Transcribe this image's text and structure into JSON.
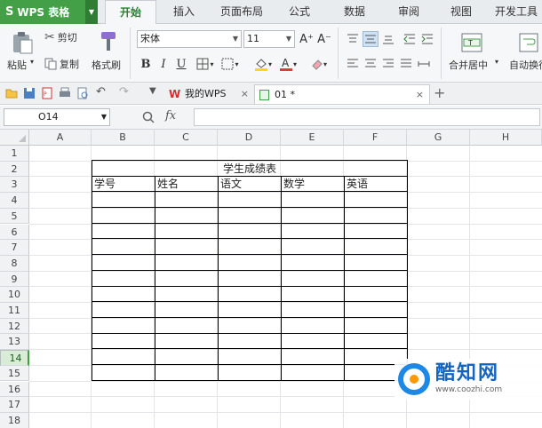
{
  "app": {
    "logo": "S",
    "name": "WPS 表格"
  },
  "tabs": [
    "开始",
    "插入",
    "页面布局",
    "公式",
    "数据",
    "审阅",
    "视图",
    "开发工具"
  ],
  "ribbon": {
    "clipboard": {
      "paste": "粘贴",
      "cut": "剪切",
      "copy": "复制",
      "format_painter": "格式刷"
    },
    "font": {
      "name": "宋体",
      "size": "11",
      "bold": "B",
      "italic": "I",
      "underline": "U",
      "grow": "A⁺",
      "shrink": "A⁻"
    },
    "merge_center": "合并居中",
    "wrap_text": "自动换行"
  },
  "doc_tabs": [
    {
      "label": "我的WPS"
    },
    {
      "label": "01 *"
    }
  ],
  "formula_bar": {
    "cell_ref": "O14",
    "fx": "fx",
    "content": ""
  },
  "columns": [
    "A",
    "B",
    "C",
    "D",
    "E",
    "F",
    "G",
    "H"
  ],
  "rows": [
    "1",
    "2",
    "3",
    "4",
    "5",
    "6",
    "7",
    "8",
    "9",
    "10",
    "11",
    "12",
    "13",
    "14",
    "15",
    "16",
    "17",
    "18"
  ],
  "selected_row": "14",
  "table": {
    "title": "学生成绩表",
    "headers": [
      "学号",
      "姓名",
      "语文",
      "数学",
      "英语"
    ]
  },
  "watermark": {
    "brand": "酷知网",
    "url": "www.coozhi.com"
  },
  "colors": {
    "accent": "#43a047",
    "border": "#000000"
  }
}
